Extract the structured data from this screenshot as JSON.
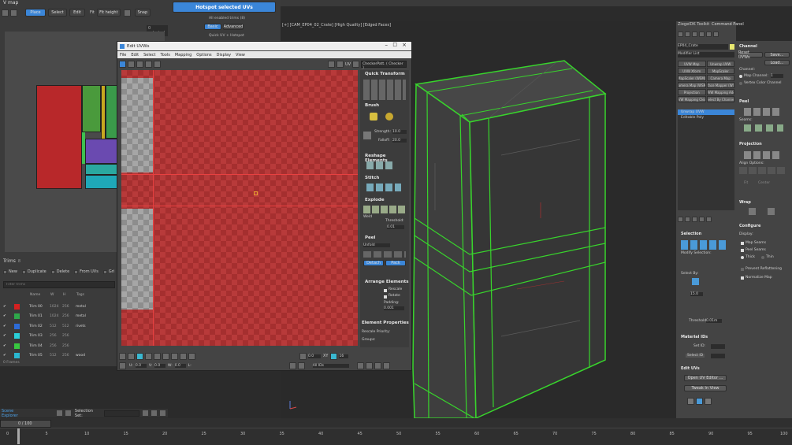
{
  "left_top": {
    "title": "V map",
    "place_label": "Place",
    "select_label": "Select",
    "edit_label": "Edit",
    "fit_label": "Fit",
    "fit_height_label": "Fit height",
    "snap_label": "Snap",
    "selected_count": "0 selected"
  },
  "hotspot": {
    "button_label": "Hotspot selected UVs",
    "enabled_trims": "All enabled trims (8)",
    "tab_basic": "Basic",
    "tab_advanced": "Advanced",
    "mode": "Quick UV + Hotspot"
  },
  "trims": {
    "title": "Trims",
    "count": "8",
    "toolbar": [
      "New",
      "Duplicate",
      "Delete",
      "From UVs",
      "Gri"
    ],
    "filter_placeholder": "Filter trims",
    "columns": [
      "Name",
      "W",
      "H",
      "Tags"
    ],
    "rows": [
      {
        "color": "#d42020",
        "name": "Trim 00",
        "w": "1024",
        "h": "256",
        "tag": "metal"
      },
      {
        "color": "#2ea84a",
        "name": "Trim 01",
        "w": "1024",
        "h": "256",
        "tag": "metal"
      },
      {
        "color": "#2d6bd6",
        "name": "Trim 02",
        "w": "512",
        "h": "512",
        "tag": "rivets"
      },
      {
        "color": "#2ad0d8",
        "name": "Trim 03",
        "w": "256",
        "h": "256",
        "tag": ""
      },
      {
        "color": "#38c840",
        "name": "Trim 04",
        "w": "256",
        "h": "256",
        "tag": ""
      },
      {
        "color": "#2ab8d0",
        "name": "Trim 05",
        "w": "512",
        "h": "256",
        "tag": "wood"
      }
    ],
    "footer": "0 Frames"
  },
  "scene_explorer": {
    "title": "Scene Explorer",
    "selection_set_label": "Selection Set:"
  },
  "timeline": {
    "frame": "0 / 100",
    "ticks": [
      "0",
      "5",
      "10",
      "15",
      "20",
      "25",
      "30",
      "35",
      "40",
      "45",
      "50",
      "55",
      "60",
      "65",
      "70",
      "75",
      "80",
      "85",
      "90",
      "95",
      "100"
    ]
  },
  "viewport": {
    "label": "[+] [CAM_EP04_02_Crate] [High Quality] [Edged Faces]"
  },
  "uvw_editor": {
    "title": "Edit UVWs",
    "menu": [
      "File",
      "Edit",
      "Select",
      "Tools",
      "Mapping",
      "Options",
      "Display",
      "View"
    ],
    "checker_label": "CheckerPatt. ( Checker )",
    "uv_label": "UV",
    "sections": {
      "quick_transform": "Quick Transform",
      "brush": "Brush",
      "strength_label": "Strength:",
      "strength_value": "10.0",
      "falloff_label": "Falloff:",
      "falloff_value": "20.0",
      "reshape": "Reshape Elements",
      "stitch": "Stitch",
      "explode": "Explode",
      "weld_label": "Weld",
      "threshold_label": "Threshold:",
      "threshold_value": "0.01",
      "peel": "Peel",
      "peel_mode": "Unfold",
      "detach_label": "Detach",
      "pack_label": "Pack",
      "arrange": "Arrange Elements",
      "rescale_label": "Rescale",
      "rotate_label": "Rotate",
      "padding_label": "Padding:",
      "padding_value": "0.001",
      "element_props": "Element Properties",
      "rescale_priority_label": "Rescale Priority:",
      "groups_label": "Groups:"
    },
    "bottom": {
      "u_label": "U:",
      "u_value": "0.0",
      "v_label": "V:",
      "v_value": "0.0",
      "w_label": "W:",
      "w_value": "0.0",
      "l_label": "L:",
      "all_ids": "All IDs",
      "xy_label": "XY",
      "zoom_value": "0.0",
      "count": "16"
    }
  },
  "ziegen_toolbar": {
    "title": "ZiegelDK Toolkit",
    "command_panel": "Command Panel",
    "object_name": "EP04_Crate",
    "modifier_list": "Modifier List",
    "modifier_buttons": [
      "UVW Map",
      "Unwrap UVW",
      "UVW Xform",
      "MapScaler",
      "MapScaler (WSM)",
      "Camera Map",
      "Camera Map (WSM)",
      "Surface Mapper (WSM)",
      "Projection",
      "UVW Mapping Add",
      "UVW Mapping Clear",
      "Select By Channel"
    ],
    "stack": [
      "Unwrap UVW",
      "Editable Poly"
    ],
    "selection_title": "Selection",
    "modify_selection": "Modify Selection:",
    "select_by": "Select By:",
    "select_by_value": "15.0",
    "threshold_label": "Threshold:",
    "threshold_value": "0.01m",
    "material_ids_title": "Material IDs",
    "set_id_label": "Set ID:",
    "select_id_label": "Select ID",
    "edit_uvs_title": "Edit UVs",
    "open_editor": "Open UV Editor ...",
    "tweak_view": "Tweak In View"
  },
  "channel_panel": {
    "channel_title": "Channel",
    "reset_uvws": "Reset UVWs",
    "save": "Save...",
    "load": "Load...",
    "channel_label": "Channel:",
    "map_channel": "Map Channel:",
    "map_channel_value": "1",
    "vertex_color": "Vertex Color Channel",
    "peel_title": "Peel",
    "seams_label": "Seams:",
    "projection_title": "Projection",
    "align_options": "Align Options:",
    "fit_label": "Fit",
    "center_label": "Center",
    "wrap_title": "Wrap",
    "configure_title": "Configure",
    "display_label": "Display:",
    "map_seams": "Map Seams",
    "peel_seams": "Peel Seams",
    "thick": "Thick",
    "thin": "Thin",
    "prevent_reflattening": "Prevent Reflattening",
    "normalize_map": "Normalize Map"
  }
}
